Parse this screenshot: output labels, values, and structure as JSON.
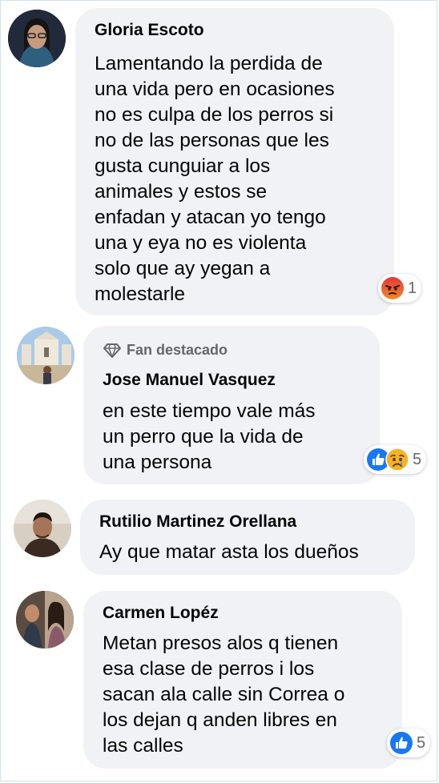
{
  "comments": [
    {
      "author": "Gloria Escoto",
      "lines": [
        "Lamentando la perdida de",
        "una vida pero en ocasiones",
        "no es culpa de los perros si",
        "no de las personas que les",
        "gusta cunguiar a los",
        "animales y estos se",
        "enfadan y atacan yo tengo",
        "una y eya no es violenta",
        "solo que ay yegan a",
        "molestarle"
      ],
      "reactions": [
        "angry-icon"
      ],
      "reaction_count": "1"
    },
    {
      "badge": "Fan destacado",
      "badge_icon": "diamond-icon",
      "author": "Jose Manuel Vasquez",
      "lines": [
        "en este tiempo vale más",
        "un perro que la vida de",
        "una persona"
      ],
      "reactions": [
        "like-icon",
        "sad-icon"
      ],
      "reaction_count": "5"
    },
    {
      "author": "Rutilio Martinez Orellana",
      "lines": [
        "Ay que matar asta los dueños"
      ]
    },
    {
      "author": "Carmen Lopéz",
      "lines": [
        "Metan presos alos q tienen",
        "esa clase de perros i los",
        "sacan ala calle sin Correa o",
        "los dejan q anden libres en",
        "las calles"
      ],
      "reactions": [
        "like-icon"
      ],
      "reaction_count": "5"
    }
  ],
  "colors": {
    "bubble": "#f0f2f5",
    "like": "#1877f2",
    "angry": "#e9710f",
    "sad": "#f7b125",
    "meta_text": "#65676b"
  }
}
